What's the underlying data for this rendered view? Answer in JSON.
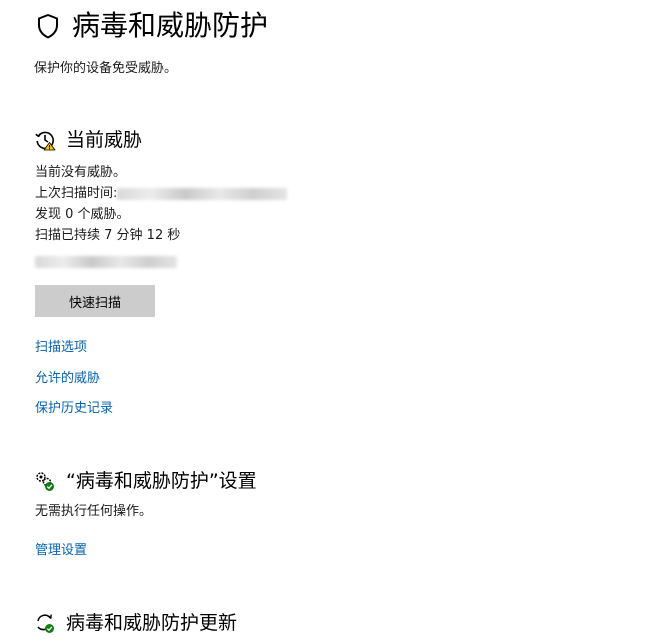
{
  "header": {
    "title": "病毒和威胁防护",
    "subtitle": "保护你的设备免受威胁。",
    "icon": "shield-icon"
  },
  "current_threats": {
    "heading": "当前威胁",
    "icon": "history-warning-icon",
    "lines": {
      "no_threats": "当前没有威胁。",
      "last_scan_label": "上次扫描时间:",
      "found": "发现 0 个威胁。",
      "duration": "扫描已持续 7 分钟 12 秒"
    },
    "quick_scan_button": "快速扫描",
    "links": {
      "scan_options": "扫描选项",
      "allowed_threats": "允许的威胁",
      "protection_history": "保护历史记录"
    }
  },
  "settings": {
    "heading": "“病毒和威胁防护”设置",
    "icon": "settings-gears-icon",
    "status": "无需执行任何操作。",
    "manage_link": "管理设置"
  },
  "updates": {
    "heading": "病毒和威胁防护更新",
    "icon": "refresh-check-icon"
  },
  "colors": {
    "link": "#0a62a8",
    "button_bg": "#cccccc",
    "warning": "#f2c200",
    "ok_green": "#107c10"
  }
}
